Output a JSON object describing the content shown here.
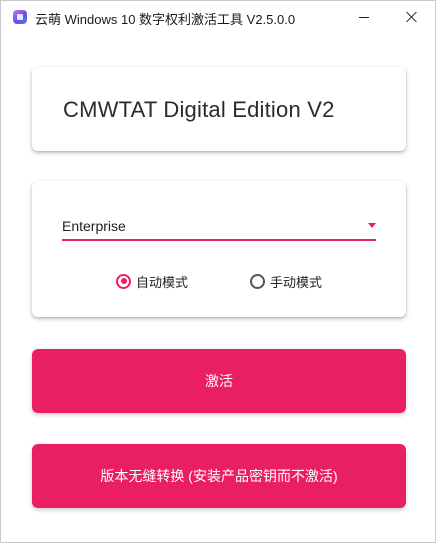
{
  "window": {
    "title": "云萌 Windows 10 数字权利激活工具 V2.5.0.0",
    "icon": "app-icon",
    "controls": [
      "minimize-icon",
      "close-icon"
    ]
  },
  "header": {
    "heading": "CMWTAT Digital Edition V2"
  },
  "options": {
    "edition_select": {
      "value": "Enterprise",
      "icon": "dropdown-arrow-icon"
    },
    "mode": {
      "auto_label": "自动模式",
      "manual_label": "手动模式",
      "selected": "auto"
    }
  },
  "actions": {
    "activate_label": "激活",
    "convert_label": "版本无缝转换 (安装产品密钥而不激活)"
  },
  "colors": {
    "accent": "#ea1f61",
    "background": "#ffffff",
    "text": "#222222"
  }
}
